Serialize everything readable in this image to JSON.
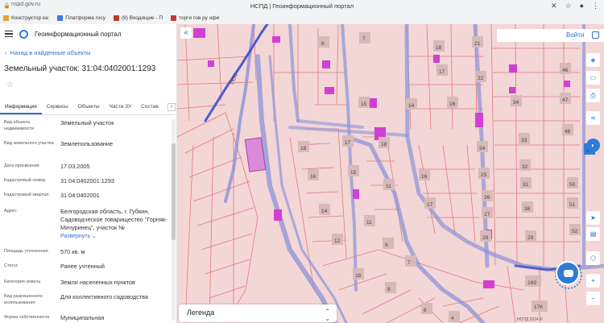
{
  "browser": {
    "url": "nspd.gov.ru",
    "title": "НСПД | Геоинформационный портал",
    "bookmarks": [
      "Конструктор ка:",
      "Платформа госу",
      "(8) Входящие - П",
      "торги гов ру офи"
    ]
  },
  "panel": {
    "app_title": "Геоинформационный портал",
    "back_link": "Назад в найденные объекты",
    "object_title": "Земельный участок: 31:04:0402001:1293",
    "tabs": [
      "Информация",
      "Сервисы",
      "Объекты",
      "Части ЗУ",
      "Состав"
    ],
    "rows": [
      {
        "label": "Вид объекта недвижимости",
        "value": "Земельный участок"
      },
      {
        "label": "Вид земельного участка",
        "value": "Землепользование"
      },
      {
        "label": "Дата присвоения",
        "value": "17.03.2005"
      },
      {
        "label": "Кадастровый номер",
        "value": "31:04:0402001:1293"
      },
      {
        "label": "Кадастровый квартал",
        "value": "31:04:0402001"
      },
      {
        "label": "Адрес",
        "value": "Белгородская область, г. Губкин, Садоводческое товарищество \"Горняк-Мичуринец\", участок №"
      },
      {
        "label": "Площадь уточненная",
        "value": "570 кв. м"
      },
      {
        "label": "Статус",
        "value": "Ранее учтенный"
      },
      {
        "label": "Категория земель",
        "value": "Земли населенных пунктов"
      },
      {
        "label": "Вид разрешенного использования",
        "value": "Для коллективного садоводства"
      },
      {
        "label": "Форма собственности",
        "value": "Муниципальная"
      }
    ],
    "expand_label": "Развернуть"
  },
  "map": {
    "login": "Войти",
    "legend": "Легенда",
    "copyright": "НСПД 2024 ©",
    "road_label": "ПОС",
    "lot_numbers": [
      "6",
      "7",
      "18",
      "21",
      "17",
      "22",
      "46",
      "14",
      "15",
      "16",
      "24",
      "34",
      "47",
      "18",
      "17",
      "18",
      "33",
      "48",
      "16",
      "15",
      "11",
      "16",
      "25",
      "32",
      "49",
      "17",
      "26",
      "31",
      "50",
      "14",
      "11",
      "27",
      "38",
      "51",
      "12",
      "9",
      "28",
      "29",
      "52",
      "7",
      "18",
      "169",
      "8",
      "176",
      "6",
      "4"
    ]
  },
  "colors": {
    "accent": "#2e6fd1",
    "parcel_fill": "#f2d4d4",
    "parcel_line": "#e07070",
    "road": "#7f8ed8",
    "building": "#d23fd2"
  }
}
